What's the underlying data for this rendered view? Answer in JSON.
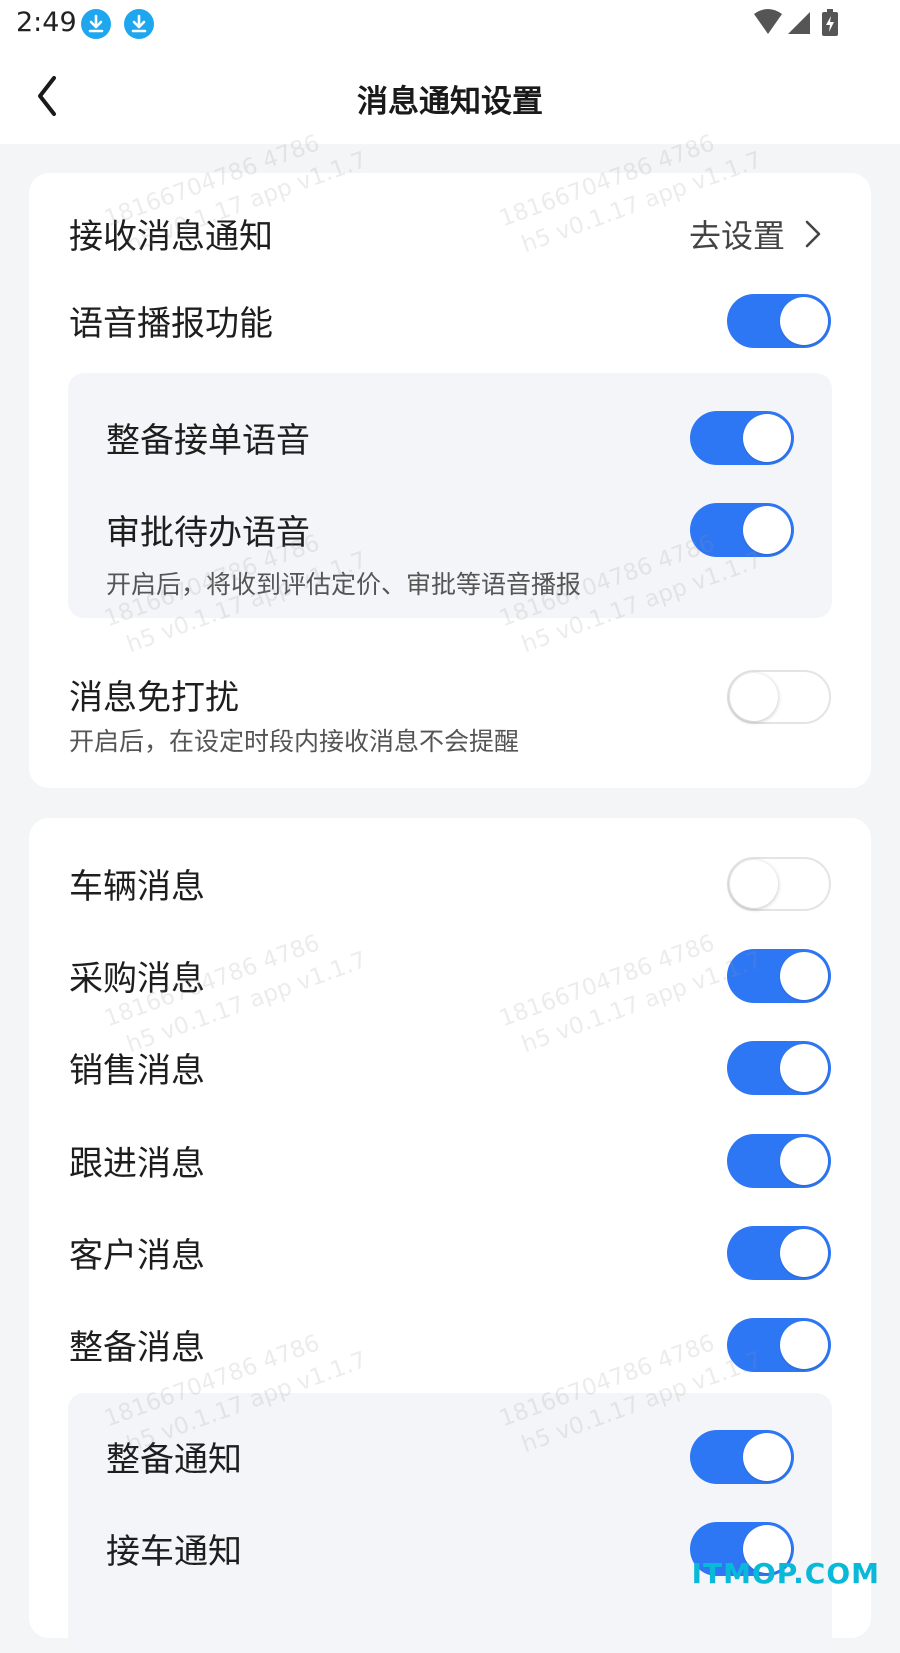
{
  "status_bar": {
    "time": "2:49"
  },
  "header": {
    "title": "消息通知设置"
  },
  "card1": {
    "receive": {
      "label": "接收消息通知",
      "action": "去设置"
    },
    "voice": {
      "label": "语音播报功能",
      "on": true
    },
    "voice_sub": {
      "items": [
        {
          "label": "整备接单语音",
          "on": true
        },
        {
          "label": "审批待办语音",
          "on": true
        }
      ],
      "desc": "开启后，将收到评估定价、审批等语音播报"
    },
    "dnd": {
      "label": "消息免打扰",
      "desc": "开启后，在设定时段内接收消息不会提醒",
      "on": false
    }
  },
  "card2": {
    "items": [
      {
        "label": "车辆消息",
        "on": false
      },
      {
        "label": "采购消息",
        "on": true
      },
      {
        "label": "销售消息",
        "on": true
      },
      {
        "label": "跟进消息",
        "on": true
      },
      {
        "label": "客户消息",
        "on": true
      },
      {
        "label": "整备消息",
        "on": true
      }
    ],
    "sub": [
      {
        "label": "整备通知",
        "on": true
      },
      {
        "label": "接车通知",
        "on": true
      }
    ]
  },
  "watermark": {
    "line1": "18166704786 4786",
    "line2": "h5 v0.1.17 app v1.1.7"
  },
  "corner_logo": "ITMOP.COM",
  "colors": {
    "accent": "#2e77f4",
    "panel": "#f4f5f8"
  }
}
